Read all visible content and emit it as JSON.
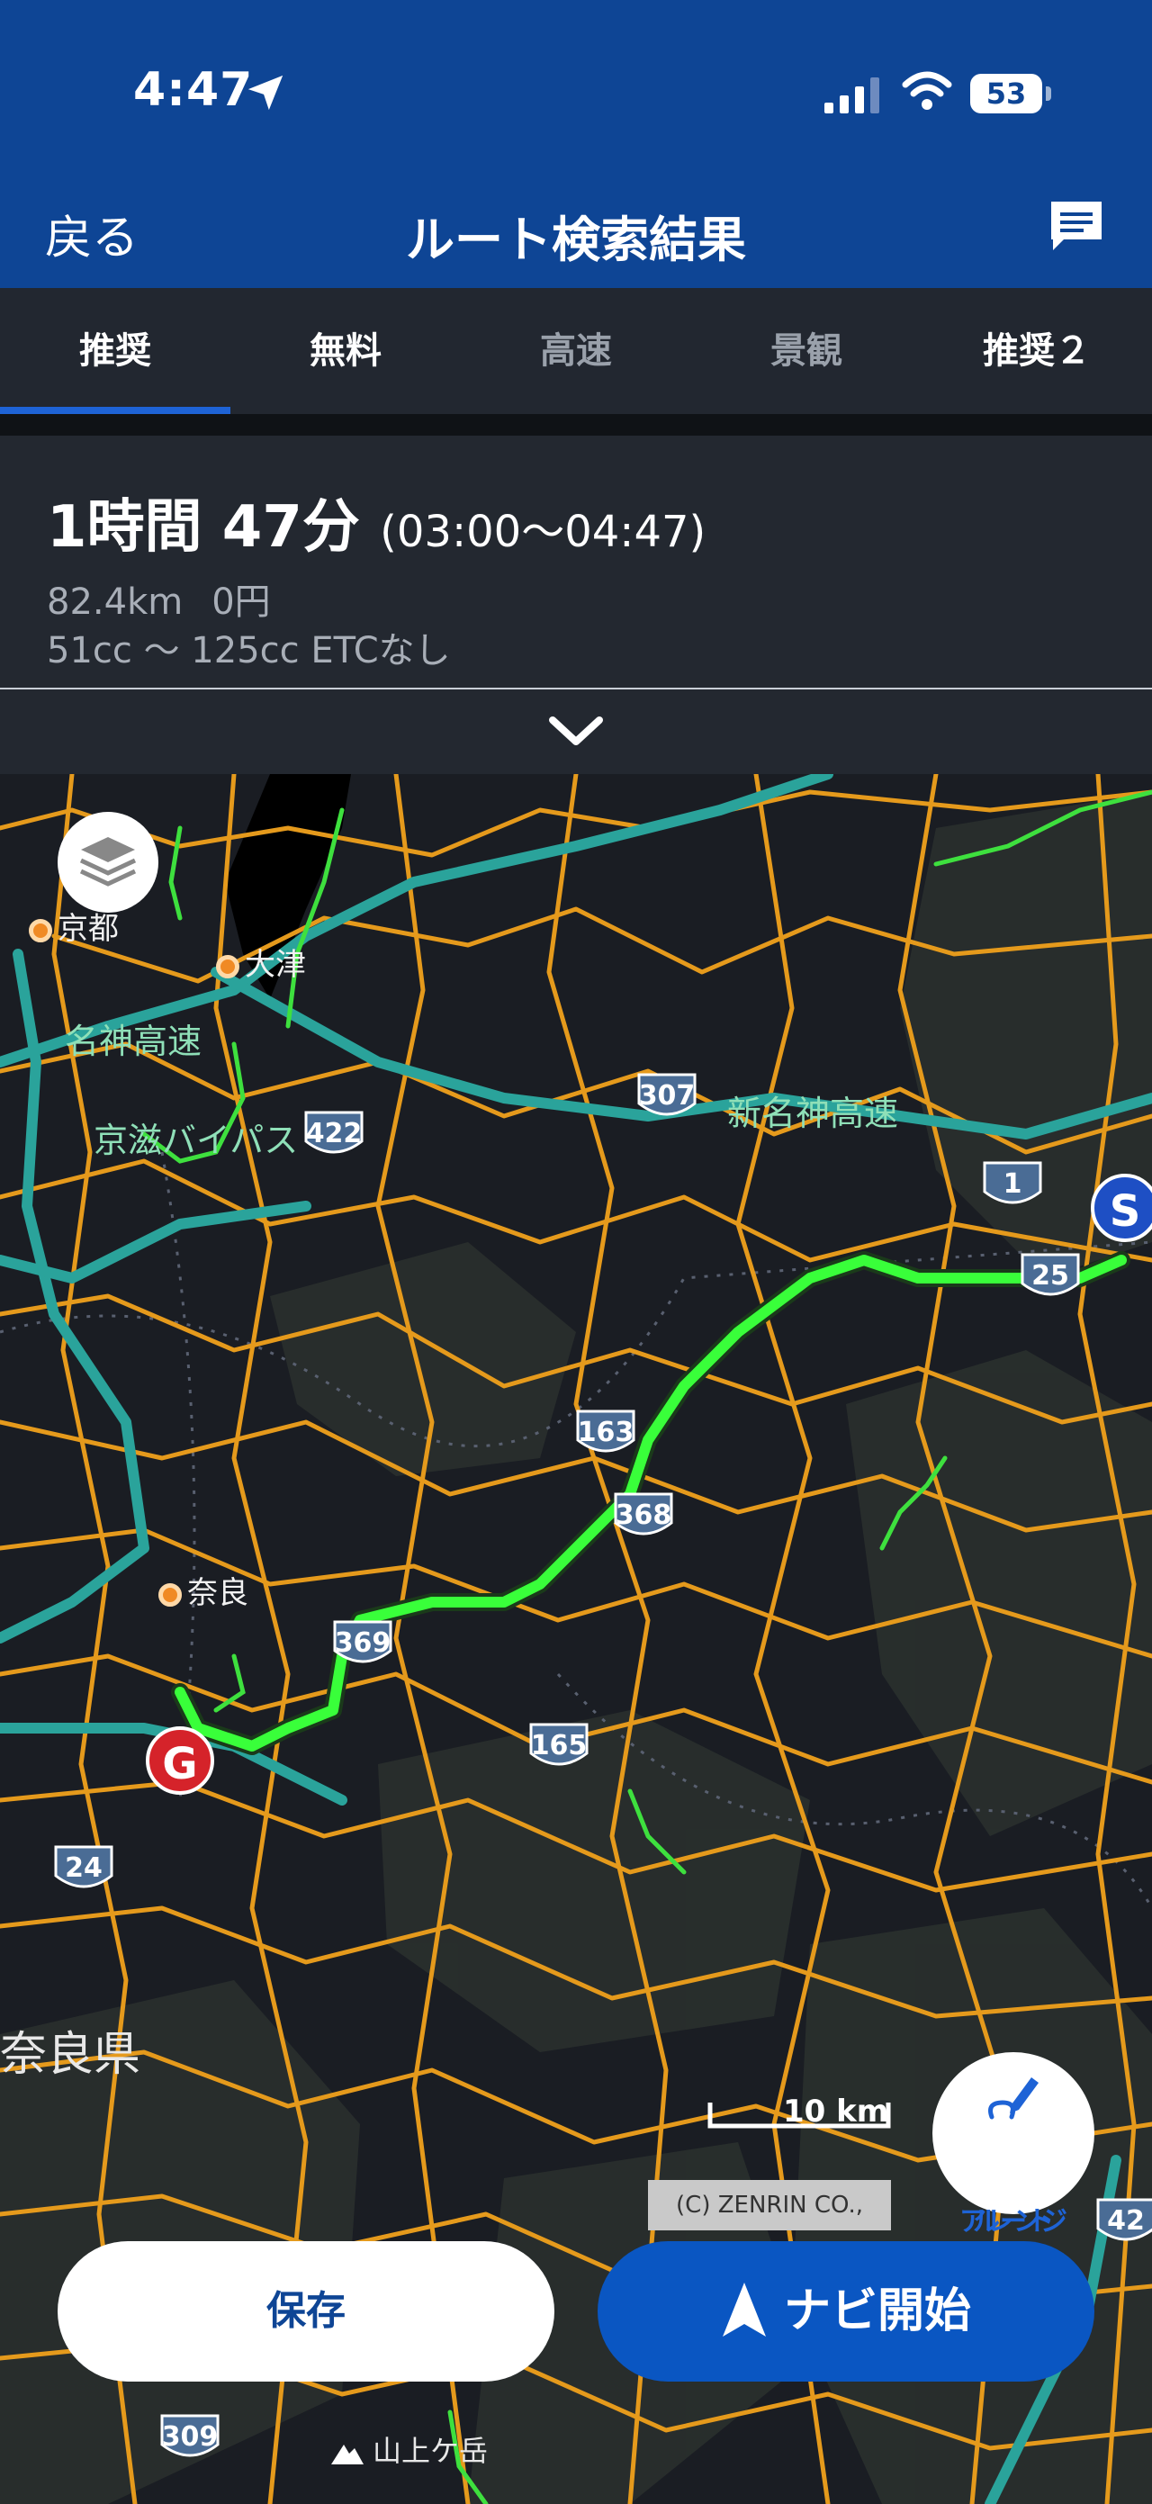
{
  "status_bar": {
    "time": "4:47",
    "battery": "53",
    "icons": [
      "location-arrow-icon",
      "cellular-signal-icon",
      "wifi-icon",
      "battery-icon"
    ]
  },
  "nav": {
    "back_label": "戻る",
    "title": "ルート検索結果",
    "chat_icon": "chat-icon"
  },
  "tabs": [
    {
      "label": "推奨",
      "selected": true
    },
    {
      "label": "無料",
      "selected": false
    },
    {
      "label": "高速",
      "selected": false
    },
    {
      "label": "景観",
      "selected": false
    },
    {
      "label": "推奨２",
      "selected": false
    }
  ],
  "summary": {
    "duration": "1時間 47分",
    "time_range": "(03:00〜04:47)",
    "distance": "82.4km",
    "cost": "0円",
    "vehicle": "51cc 〜 125cc ETCなし"
  },
  "map": {
    "places": [
      "京都",
      "大津",
      "奈良"
    ],
    "road_names": [
      "名神高速",
      "京滋バイパス",
      "新名神高速"
    ],
    "prefecture": "奈良県",
    "route_shields": [
      "307",
      "422",
      "1",
      "25",
      "163",
      "368",
      "369",
      "165",
      "24",
      "309",
      "42"
    ],
    "start_marker": "S",
    "goal_marker": "G",
    "scale": "10 km",
    "copyright": "(C) ZENRIN CO., LTD.",
    "peak": "山上ケ岳",
    "route_arrange_label_1": "ルート",
    "route_arrange_label_2": "アレンジ",
    "colors": {
      "route": "#39ff3a",
      "expressway": "#2aa39b",
      "road": "#e59a1c"
    }
  },
  "buttons": {
    "save": "保存",
    "navigate": "ナビ開始"
  }
}
